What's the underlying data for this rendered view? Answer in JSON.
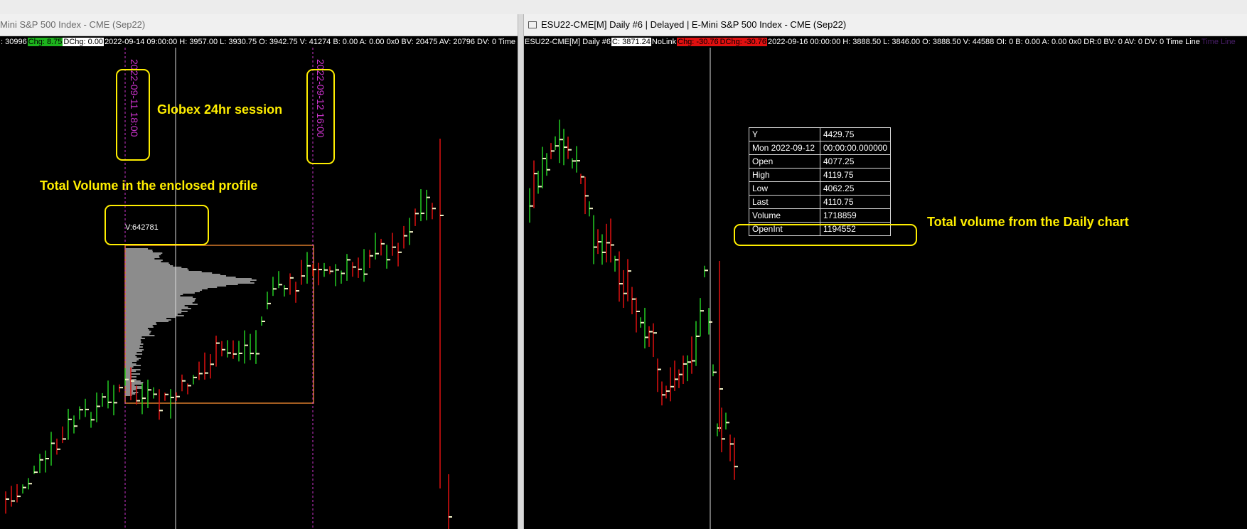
{
  "left_pane": {
    "title": "Mini S&P 500 Index - CME (Sep22)",
    "info": {
      "lead": ": 30996",
      "chg": "Chg: 8.75",
      "dchg": "DChg: 0.00",
      "rest": "2022-09-14 09:00:00 H: 3957.00 L: 3930.75 O: 3942.75 V: 41274 B: 0.00 A: 0.00 0x0 BV: 20475 AV: 20796 DV: 0 Time"
    },
    "session_marker_1": "2022-09-11  18:00",
    "session_marker_2": "2022-09-12  16:00",
    "profile_volume": "V:642781",
    "annotation_session": "Globex 24hr session",
    "annotation_volume": "Total Volume in the enclosed profile"
  },
  "right_pane": {
    "title": "ESU22-CME[M]  Daily #6 | Delayed | E-Mini S&P 500 Index - CME (Sep22)",
    "info": {
      "symbol": "ESU22-CME[M]  Daily #6",
      "c": "C: 3871.24",
      "nolink": "NoLink",
      "chg": "Chg: -30.76",
      "dchg": "DChg: -30.76",
      "rest": "2022-09-16 00:00:00 H: 3888.50 L: 3846.00 O: 3888.50 V: 44588 OI: 0 B: 0.00 A: 0.00 0x0 DR:0 BV: 0 AV: 0 DV: 0 Time Line",
      "tail": "Time Line"
    },
    "data_window": [
      {
        "label": "Y",
        "value": "4429.75"
      },
      {
        "label": "Mon 2022-09-12",
        "value": "00:00:00.000000"
      },
      {
        "label": "Open",
        "value": "4077.25"
      },
      {
        "label": "High",
        "value": "4119.75"
      },
      {
        "label": "Low",
        "value": "4062.25"
      },
      {
        "label": "Last",
        "value": "4110.75"
      },
      {
        "label": "Volume",
        "value": "1718859"
      },
      {
        "label": "OpenInt",
        "value": "1194552"
      }
    ],
    "annotation_daily": "Total volume from the Daily chart"
  },
  "colors": {
    "up": "#22cc22",
    "down": "#e01010",
    "marker": "#cc33cc",
    "highlight": "#ffee00",
    "box": "#d77a2a",
    "profile": "#8c8c8c"
  }
}
